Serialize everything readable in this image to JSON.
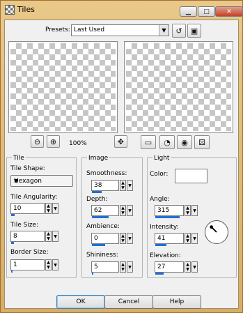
{
  "window": {
    "title": "Tiles"
  },
  "titlebar": {
    "minimize": "▁",
    "maximize": "□",
    "close": "✕"
  },
  "presets": {
    "label": "Presets:",
    "value": "Last Used"
  },
  "zoom": {
    "level": "100%"
  },
  "tile": {
    "group_title": "Tile",
    "shape_label": "Tile Shape:",
    "shape_value": "Hexagon",
    "angularity_label": "Tile Angularity:",
    "angularity_value": "10",
    "angularity_fraction": 0.1,
    "size_label": "Tile Size:",
    "size_value": "8",
    "size_fraction": 0.08,
    "border_label": "Border Size:",
    "border_value": "1",
    "border_fraction": 0.05
  },
  "image": {
    "group_title": "Image",
    "smoothness_label": "Smoothness:",
    "smoothness_value": "38",
    "smoothness_fraction": 0.38,
    "depth_label": "Depth:",
    "depth_value": "62",
    "depth_fraction": 0.62,
    "ambience_label": "Ambience:",
    "ambience_value": "0",
    "ambience_fraction": 0.5,
    "shininess_label": "Shininess:",
    "shininess_value": "5",
    "shininess_fraction": 0.05
  },
  "light": {
    "group_title": "Light",
    "color_label": "Color:",
    "color_value": "#ffffff",
    "angle_label": "Angle:",
    "angle_value": "315",
    "angle_fraction": 0.875,
    "intensity_label": "Intensity:",
    "intensity_value": "41",
    "intensity_fraction": 0.41,
    "elevation_label": "Elevation:",
    "elevation_value": "27",
    "elevation_fraction": 0.3
  },
  "buttons": {
    "ok": "OK",
    "cancel": "Cancel",
    "help": "Help"
  },
  "icons": {
    "zoom_out": "zoom-out-icon",
    "zoom_in": "zoom-in-icon",
    "pan": "pan-icon",
    "proof": "proof-icon",
    "randomize": "randomize-icon",
    "save_preset": "save-preset-icon",
    "reset": "reset-icon"
  },
  "colors": {
    "accent": "#1e6fd6",
    "frame": "#d6ae66"
  }
}
